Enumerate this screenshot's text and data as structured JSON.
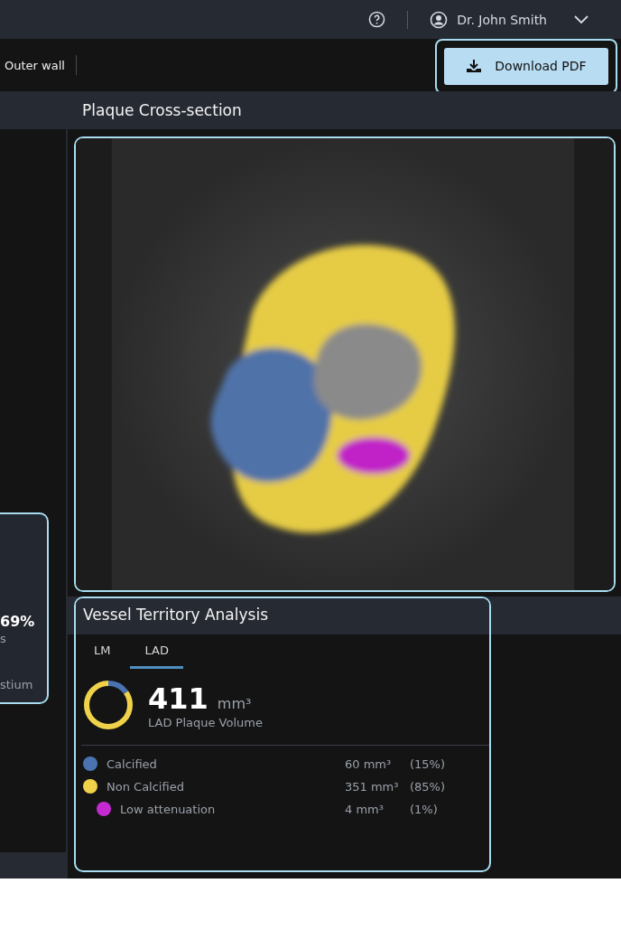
{
  "header": {
    "user_name": "Dr. John Smith"
  },
  "toolbar": {
    "label": "Outer wall",
    "button": "Download PDF"
  },
  "left_card": {
    "value": "69%",
    "line_2": "s",
    "line_3": "stium"
  },
  "cross_section": {
    "title": "Plaque Cross-section"
  },
  "vessel": {
    "title": "Vessel Territory Analysis",
    "tabs": [
      {
        "label": "LM",
        "selected": false
      },
      {
        "label": "LAD",
        "selected": true
      }
    ],
    "total": "411",
    "unit": "mm³",
    "caption": "LAD Plaque Volume",
    "items": [
      {
        "label": "Calcified",
        "color": "#4a74b0",
        "volume": "60 mm³",
        "percent": "(15%)",
        "kind": "main"
      },
      {
        "label": "Non Calcified",
        "color": "#f0d24a",
        "volume": "351 mm³",
        "percent": "(85%)",
        "kind": "main"
      },
      {
        "label": "Low attenuation",
        "color": "#c42ad0",
        "volume": "4 mm³",
        "percent": "(1%)",
        "kind": "sub"
      }
    ]
  }
}
